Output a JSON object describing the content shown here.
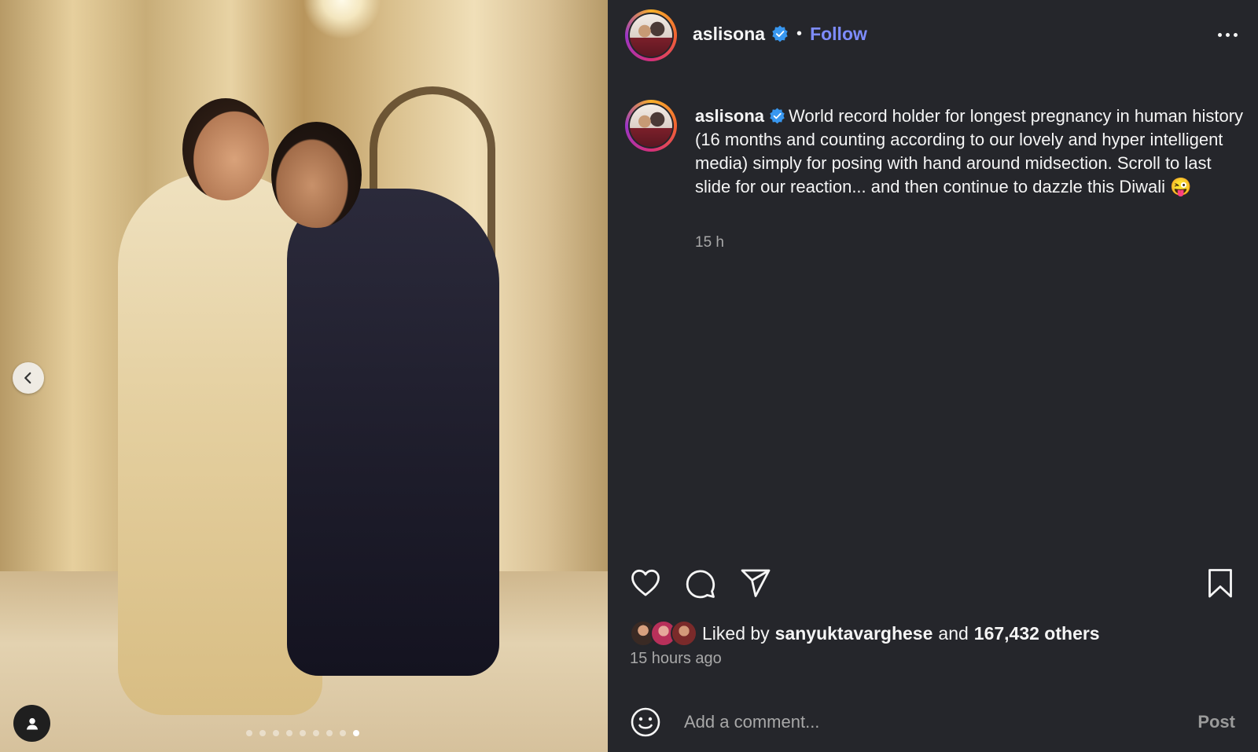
{
  "post": {
    "username": "aslisona",
    "separator": "•",
    "follow_label": "Follow",
    "caption_username": "aslisona",
    "caption_text": "World record holder for longest pregnancy in human history (16 months and counting according to our lovely and hyper intelligent media) simply for posing with hand around midsection. Scroll to last slide for our reaction... and then continue to dazzle this Diwali 😜",
    "caption_time": "15 h",
    "liked_by_prefix": "Liked by",
    "liked_by_user": "sanyuktavarghese",
    "liked_by_and": "and",
    "liked_by_others": "167,432 others",
    "posted_ago": "15 hours ago",
    "comment_placeholder": "Add a comment...",
    "post_label": "Post"
  },
  "carousel": {
    "total_slides": 9,
    "active_slide": 9
  },
  "icons": {
    "verified": "verified-badge-icon",
    "more": "more-options-icon",
    "like": "heart-icon",
    "comment": "comment-bubble-icon",
    "share": "paper-plane-icon",
    "save": "bookmark-icon",
    "emoji": "smiley-icon",
    "prev": "chevron-left-icon",
    "tagged": "user-icon"
  },
  "colors": {
    "background": "#25262b",
    "follow": "#7e8cff",
    "verified": "#3897f0",
    "muted": "#a8a8a8"
  }
}
